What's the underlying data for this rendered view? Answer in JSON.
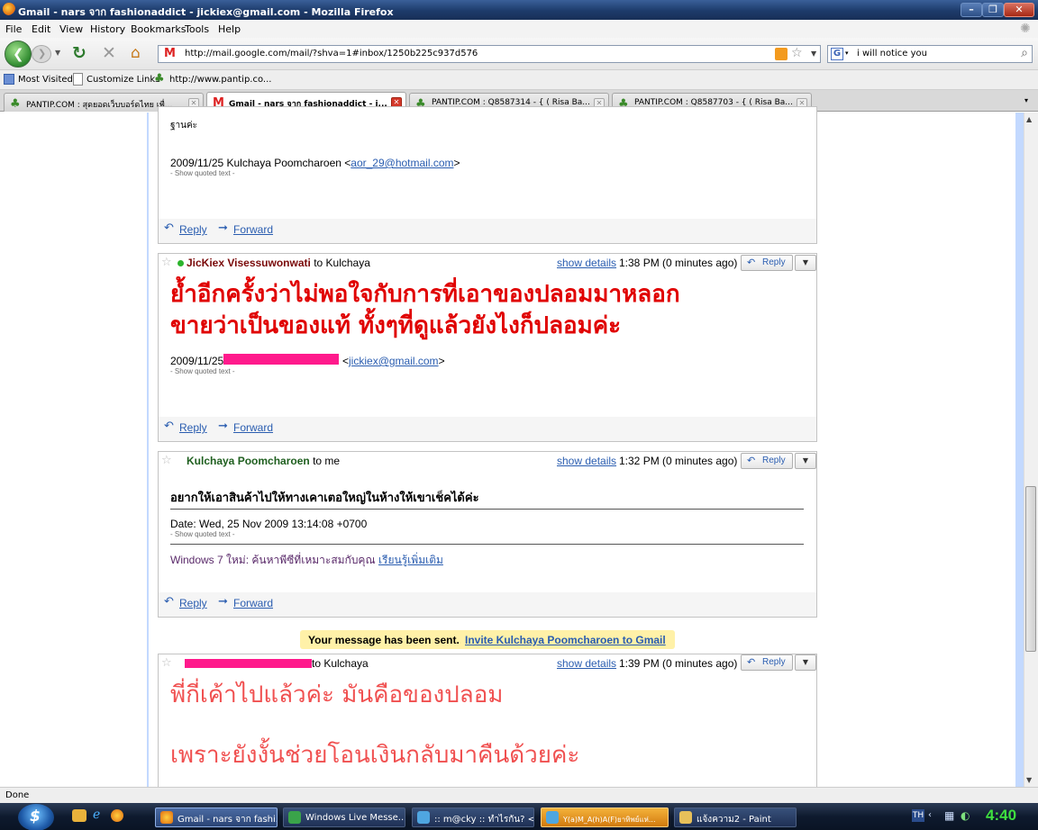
{
  "window": {
    "title": "Gmail - nars จาก fashionaddict - jickiex@gmail.com - Mozilla Firefox"
  },
  "menu": [
    "File",
    "Edit",
    "View",
    "History",
    "Bookmarks",
    "Tools",
    "Help"
  ],
  "nav": {
    "url": "http://mail.google.com/mail/?shva=1#inbox/1250b225c937d576",
    "search": "i will notice you"
  },
  "bookmarks": [
    "Most Visited",
    "Customize Links",
    "http://www.pantip.co..."
  ],
  "tabs": [
    {
      "label": "PANTIP.COM : สุดยอดเว็บบอร์ดไทย เพื่..."
    },
    {
      "label": "Gmail - nars จาก fashionaddict - j..."
    },
    {
      "label": "PANTIP.COM : Q8587314 - { ( Risa Ba..."
    },
    {
      "label": "PANTIP.COM : Q8587703 - { ( Risa Ba..."
    }
  ],
  "messages": {
    "m0": {
      "partial": "ฐานค่ะ",
      "quote_line": "2009/11/25 Kulchaya Poomcharoen <",
      "quote_email": "aor_29@hotmail.com",
      "quote_close": ">",
      "show_quoted": "- Show quoted text -"
    },
    "m1": {
      "sender": "JicKiex Visessuwonwati",
      "to": "to Kulchaya",
      "show_details": "show details",
      "time": "1:38 PM (0 minutes ago)",
      "line1": "ย้ำอีกครั้งว่าไม่พอใจกับการที่เอาของปลอมมาหลอก",
      "line2": "ขายว่าเป็นของแท้ ทั้งๆที่ดูแล้วยังไงก็ปลอมค่ะ",
      "quote_date": "2009/11/25",
      "quote_lt": "<",
      "quote_email": "jickiex@gmail.com",
      "quote_gt": ">",
      "show_quoted": "- Show quoted text -"
    },
    "m2": {
      "sender": "Kulchaya Poomcharoen",
      "to": "to me",
      "show_details": "show details",
      "time": "1:32 PM (0 minutes ago)",
      "body": "อยากให้เอาสินค้าไปให้ทางเคาเตอใหญ่ในห้างให้เขาเช็คได้ค่ะ",
      "date": "Date: Wed, 25 Nov 2009 13:14:08 +0700",
      "show_quoted": "- Show quoted text -",
      "ad_text": "Windows 7 ใหม่: ค้นหาพีซีที่เหมาะสมกับคุณ",
      "ad_link": "เรียนรู้เพิ่มเติม"
    },
    "notice": {
      "text": "Your message has been sent.",
      "link": "Invite Kulchaya Poomcharoen to Gmail"
    },
    "m3": {
      "to": "to Kulchaya",
      "show_details": "show details",
      "time": "1:39 PM (0 minutes ago)",
      "line1": "พี่กี่เค้าไปแล้วค่ะ มันคือของปลอม",
      "line2": "เพราะยังงั้นช่วยโอนเงินกลับมาคืนด้วยค่ะ"
    }
  },
  "actions": {
    "reply": "Reply",
    "forward": "Forward"
  },
  "status": "Done",
  "taskbar": [
    {
      "label": "Gmail - nars จาก fashi..."
    },
    {
      "label": "Windows Live Messe..."
    },
    {
      "label": ":: m@cky :: ทำไรกัน? <..."
    },
    {
      "label": "Y(a)M_A(h)A(F)ยาทิพย์แห่..."
    },
    {
      "label": "แจ้งความ2 - Paint"
    }
  ],
  "tray": {
    "lang": "TH",
    "clock": "4:40"
  },
  "colors": {
    "big_text": "#e00000",
    "sender": "#1f5f1f",
    "link": "#2a5db0",
    "redaction": "#ff1a8c",
    "notice_bg": "#fff1a8"
  }
}
